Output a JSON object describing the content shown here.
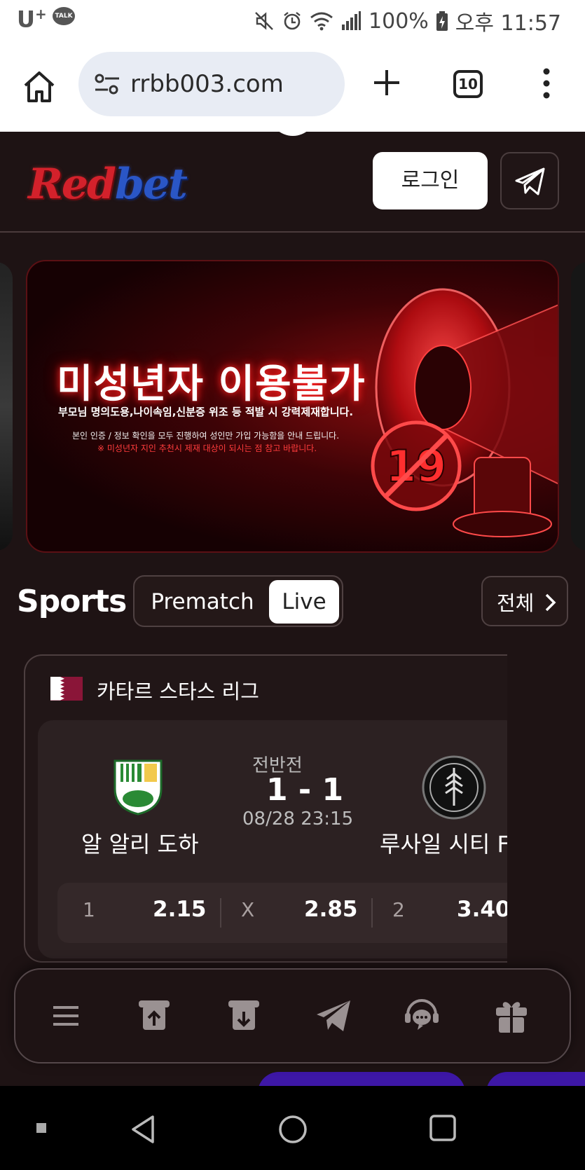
{
  "status_bar": {
    "carrier": "U",
    "talk_badge": "TALK",
    "battery": "100%",
    "time": "오후 11:57",
    "icons": [
      "mute-icon",
      "alarm-icon",
      "wifi-icon",
      "signal-icon",
      "battery-icon"
    ]
  },
  "browser": {
    "url": "rrbb003.com",
    "tab_count": "10"
  },
  "site": {
    "logo_red": "Red",
    "logo_blue": "bet",
    "login_label": "로그인"
  },
  "banner": {
    "title": "미성년자 이용불가",
    "subtitle": "부모님 명의도용,나이속임,신분증 위조 등 적발 시 강력제재합니다.",
    "note": "본인 인증 / 정보 확인을 모두 진행하여 성인만 가입 가능함을 안내 드립니다.",
    "warning": "※ 미성년자 지인 추천시 제재 대상이 되시는 점 참고 바랍니다.",
    "badge": "19"
  },
  "sports": {
    "title": "Sports",
    "tabs": [
      {
        "label": "Prematch",
        "active": false
      },
      {
        "label": "Live",
        "active": true
      }
    ],
    "all_label": "전체"
  },
  "match": {
    "league": "카타르 스타스 리그",
    "period": "전반전",
    "score": "1 - 1",
    "kickoff": "08/28 23:15",
    "home_team": "알 알리 도하",
    "away_team": "루사일 시티 F",
    "odds": [
      {
        "label": "1",
        "value": "2.15"
      },
      {
        "label": "X",
        "value": "2.85"
      },
      {
        "label": "2",
        "value": "3.40"
      }
    ]
  },
  "bottom_nav": [
    "menu-icon",
    "deposit-icon",
    "withdraw-icon",
    "telegram-icon",
    "support-chat-icon",
    "gift-icon"
  ],
  "colors": {
    "page_bg": "#1e1314",
    "accent_red": "#d3212b",
    "accent_blue": "#2a56c6",
    "peek_purple": "#3d17a6"
  }
}
